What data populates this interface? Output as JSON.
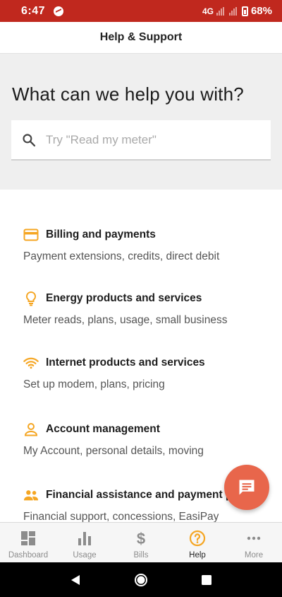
{
  "status": {
    "time": "6:47",
    "network": "4G",
    "battery": "68%"
  },
  "header": {
    "title": "Help & Support"
  },
  "hero": {
    "title": "What can we help you with?",
    "search_placeholder": "Try \"Read my meter\""
  },
  "categories": [
    {
      "title": "Billing and payments",
      "subtitle": "Payment extensions, credits, direct debit",
      "icon": "credit-card-icon"
    },
    {
      "title": "Energy products and services",
      "subtitle": "Meter reads, plans, usage, small business",
      "icon": "lightbulb-icon"
    },
    {
      "title": "Internet products and services",
      "subtitle": "Set up modem, plans, pricing",
      "icon": "wifi-icon"
    },
    {
      "title": "Account management",
      "subtitle": "My Account, personal details, moving",
      "icon": "person-icon"
    },
    {
      "title": "Financial assistance and payment p",
      "subtitle": "Financial support, concessions, EasiPay",
      "icon": "group-icon"
    }
  ],
  "tabs": [
    {
      "label": "Dashboard",
      "icon": "dashboard-icon"
    },
    {
      "label": "Usage",
      "icon": "bar-chart-icon"
    },
    {
      "label": "Bills",
      "icon": "dollar-icon"
    },
    {
      "label": "Help",
      "icon": "help-circle-icon"
    },
    {
      "label": "More",
      "icon": "more-dots-icon"
    }
  ],
  "colors": {
    "status_bar": "#c0281e",
    "accent": "#f5a623",
    "fab": "#e8664b",
    "tab_inactive": "#8c8c8c"
  }
}
